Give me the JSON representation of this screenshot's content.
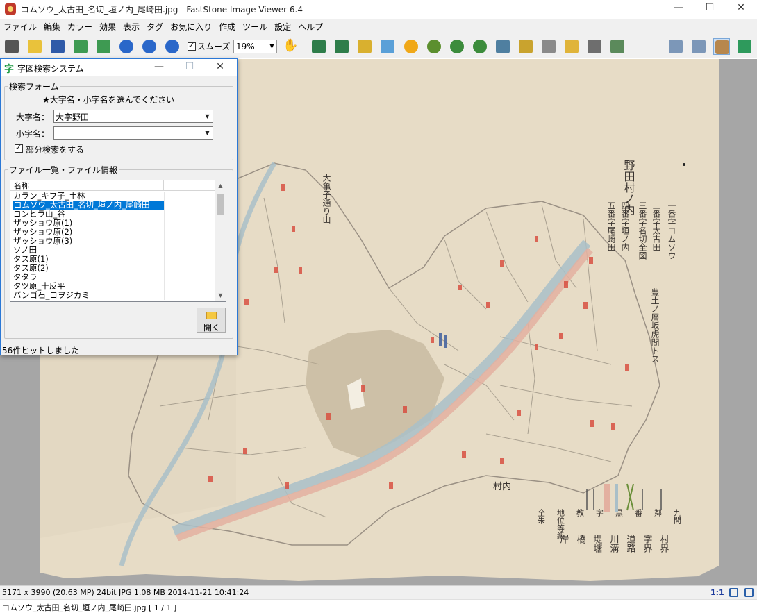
{
  "window": {
    "title": "コムソウ_太古田_名切_垣ノ内_尾崎田.jpg  -  FastStone Image Viewer 6.4",
    "minimize": "—",
    "maximize": "☐",
    "close": "✕"
  },
  "menu": [
    "ファイル",
    "編集",
    "カラー",
    "効果",
    "表示",
    "タグ",
    "お気に入り",
    "作成",
    "ツール",
    "設定",
    "ヘルプ"
  ],
  "toolbar": {
    "smooth_label": "スムーズ",
    "zoom_value": "19%",
    "icons": [
      "camera-icon",
      "open-folder-icon",
      "save-icon",
      "prev-icon",
      "next-icon",
      "zoom-in-icon",
      "zoom-out-icon",
      "actual-size-icon",
      "hand-icon",
      "resize-icon",
      "crop-icon",
      "color-icon",
      "cb-icon",
      "sun-icon",
      "stamp-icon",
      "rotate-left-icon",
      "rotate-right-icon",
      "flip-icon",
      "frame-icon",
      "eraser-icon",
      "email-icon",
      "print-icon",
      "tag-check-icon",
      "layout-a-icon",
      "layout-b-icon",
      "layout-c-icon",
      "fullscreen-icon"
    ]
  },
  "dialog": {
    "title": "字図検索システム",
    "search_form_legend": "検索フォーム",
    "instruction": "★大字名・小字名を選んでください",
    "oaza_label": "大字名：",
    "oaza_value": "大字野田",
    "koaza_label": "小字名：",
    "koaza_value": "",
    "partial_label": "部分検索をする",
    "file_list_legend": "ファイル一覧・ファイル情報",
    "column_name": "名称",
    "files": [
      "カラン_キフ子_土林",
      "コムソウ_太古田_名切_垣ノ内_尾崎田",
      "コンヒラ山_谷",
      "ザッショウ原(1)",
      "ザッショウ原(2)",
      "ザッショウ原(3)",
      "ソノ田",
      "タス原(1)",
      "タス原(2)",
      "タタラ",
      "タツ原_十反平",
      "バンゴ石_コヲジカミ"
    ],
    "selected_index": 1,
    "open_label": "開く",
    "status": "56件ヒットしました"
  },
  "map": {
    "title_column": "野田村ノ内",
    "text_lines": [
      "一番字コムソウ",
      "二番字太古田",
      "三番字名切全図",
      "四番字垣ノ内",
      "五番字尾崎田"
    ],
    "note": "豊土ノ層坂虎間トス",
    "legend_col1": [
      "村界",
      "字界",
      "道路",
      "川溝",
      "堤塘",
      "橋",
      "岸"
    ],
    "legend_col2": [
      "九間",
      "鄰",
      "番",
      "黒",
      "字",
      "教",
      "地位等級",
      "全朱"
    ],
    "village_labels": [
      "村内",
      "大亀子通り山"
    ]
  },
  "status": {
    "info": "5171 x 3990 (20.63 MP)  24bit  JPG   1.08 MB   2014-11-21 10:41:24",
    "ratio": "1:1",
    "filename": "コムソウ_太古田_名切_垣ノ内_尾崎田.jpg [ 1 / 1 ]"
  },
  "colors": {
    "selection": "#0078d7",
    "map_paper": "#e7dcc6",
    "river_blue": "#a9bfc8",
    "river_pink": "#e3b0a0",
    "viewer_bg": "#a6a6a6"
  }
}
